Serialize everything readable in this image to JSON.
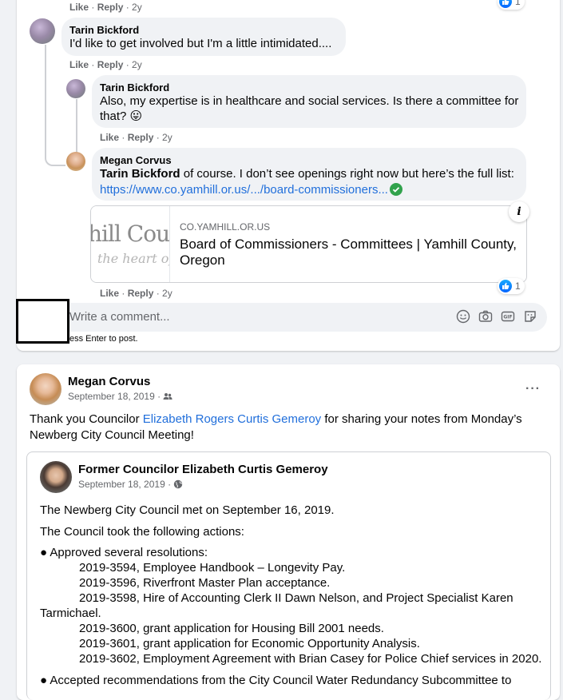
{
  "actions": {
    "like": "Like",
    "reply": "Reply",
    "time": "2y"
  },
  "comments": [
    {
      "author": "Tarin Bickford",
      "text": "I'd like to get involved but I'm a little intimidated...."
    },
    {
      "author": "Tarin Bickford",
      "text_line1": "Also, my expertise is in healthcare and social services. Is there a committee for",
      "text_line2": "that? 😛"
    },
    {
      "author": "Megan Corvus",
      "mention": "Tarin Bickford",
      "text": " of course. I don’t see openings right now but here’s the full list:",
      "url": "https://www.co.yamhill.or.us/.../board-commissioners..."
    }
  ],
  "reaction_counts": {
    "top": "1",
    "preview": "1"
  },
  "link_preview": {
    "domain": "CO.YAMHILL.OR.US",
    "title": "Board of Commissioners - Committees | Yamhill County, Oregon",
    "thumb_line1": "hill Coun",
    "thumb_line2": "the heart of"
  },
  "composer": {
    "placeholder": "Write a comment...",
    "hint": "ess Enter to post."
  },
  "post": {
    "author": "Megan Corvus",
    "date": "September 18, 2019 ·",
    "text_before": "Thank you Councilor ",
    "mention": "Elizabeth Rogers Curtis Gemeroy",
    "text_after": " for sharing your notes from Monday’s",
    "text_line2": "Newberg City Council Meeting!"
  },
  "shared": {
    "author": "Former Councilor Elizabeth Curtis Gemeroy",
    "date": "September 18, 2019 ·",
    "lines": [
      "The Newberg City Council met on September 16, 2019.",
      "The Council took the following actions:",
      "● Approved several resolutions:",
      "2019-3594, Employee Handbook – Longevity Pay.",
      "2019-3596, Riverfront Master Plan acceptance.",
      "2019-3598, Hire of Accounting Clerk II Dawn Nelson, and Project Specialist Karen",
      "Tarmichael.",
      "2019-3600, grant application for Housing Bill 2001 needs.",
      "2019-3601, grant application for Economic Opportunity Analysis.",
      "2019-3602, Employment Agreement with Brian Casey for Police Chief services in 2020.",
      "● Accepted recommendations from the City Council Water Redundancy Subcommittee to"
    ]
  },
  "colors": {
    "link": "#216fdb",
    "like_blue": "#0866ff",
    "bubble": "#f0f2f5"
  }
}
